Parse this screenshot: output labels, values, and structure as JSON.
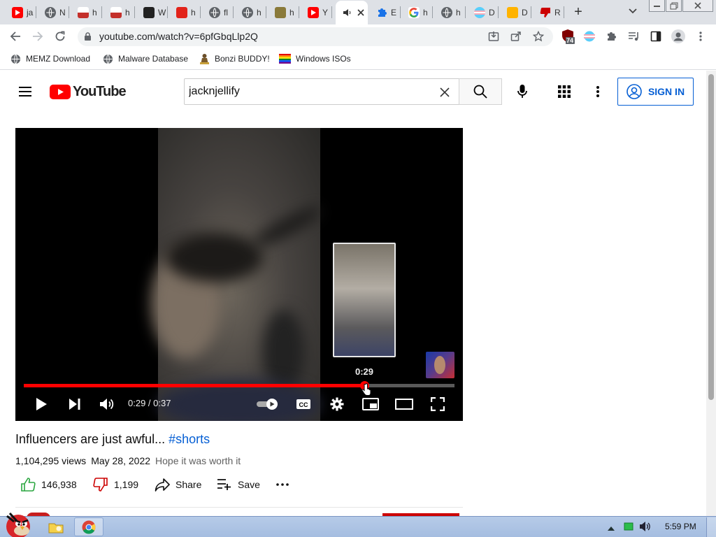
{
  "browser": {
    "tabs": [
      {
        "label": "ja",
        "icon": "youtube-icon"
      },
      {
        "label": "N",
        "icon": "globe-icon"
      },
      {
        "label": "h",
        "icon": "youtube-classic-icon"
      },
      {
        "label": "h",
        "icon": "youtube-classic-icon"
      },
      {
        "label": "W",
        "icon": "wikipedia-icon"
      },
      {
        "label": "h",
        "icon": "adobe-icon"
      },
      {
        "label": "fl",
        "icon": "globe-icon"
      },
      {
        "label": "h",
        "icon": "globe-icon"
      },
      {
        "label": "h",
        "icon": "rat-icon"
      },
      {
        "label": "Y",
        "icon": "youtube-icon"
      },
      {
        "label": "",
        "icon": "speaker-icon",
        "active": true
      },
      {
        "label": "E",
        "icon": "puzzle-icon"
      },
      {
        "label": "h",
        "icon": "google-icon"
      },
      {
        "label": "h",
        "icon": "globe-icon"
      },
      {
        "label": "D",
        "icon": "trans-flag-icon"
      },
      {
        "label": "D",
        "icon": "rainbow-icon"
      },
      {
        "label": "R",
        "icon": "thumbs-down-icon"
      }
    ],
    "new_tab_label": "+",
    "url": "youtube.com/watch?v=6pfGbqLlp2Q",
    "extension_badge": "74",
    "bookmarks": [
      {
        "label": "MEMZ Download",
        "icon": "globe-icon"
      },
      {
        "label": "Malware Database",
        "icon": "globe-icon"
      },
      {
        "label": "Bonzi BUDDY!",
        "icon": "bonzi-icon"
      },
      {
        "label": "Windows ISOs",
        "icon": "windows-flag-icon"
      }
    ]
  },
  "youtube": {
    "logo_text": "YouTube",
    "search_query": "jacknjellify",
    "sign_in_label": "SIGN IN",
    "player": {
      "current_time": "0:29",
      "duration": "0:37",
      "time_display": "0:29 / 0:37",
      "hover_time": "0:29",
      "progress_fraction": 0.79
    },
    "video": {
      "title": "Influencers are just awful... ",
      "hashtag": "#shorts",
      "views": "1,104,295 views",
      "date": "May 28, 2022",
      "description": "Hope it was worth it",
      "likes": "146,938",
      "dislikes": "1,199",
      "share_label": "Share",
      "save_label": "Save"
    }
  },
  "taskbar": {
    "clock": "5:59 PM"
  },
  "colors": {
    "youtube_red": "#ff0000",
    "link_blue": "#065fd4",
    "like_green": "#2ba640",
    "dislike_red": "#cc0000"
  }
}
